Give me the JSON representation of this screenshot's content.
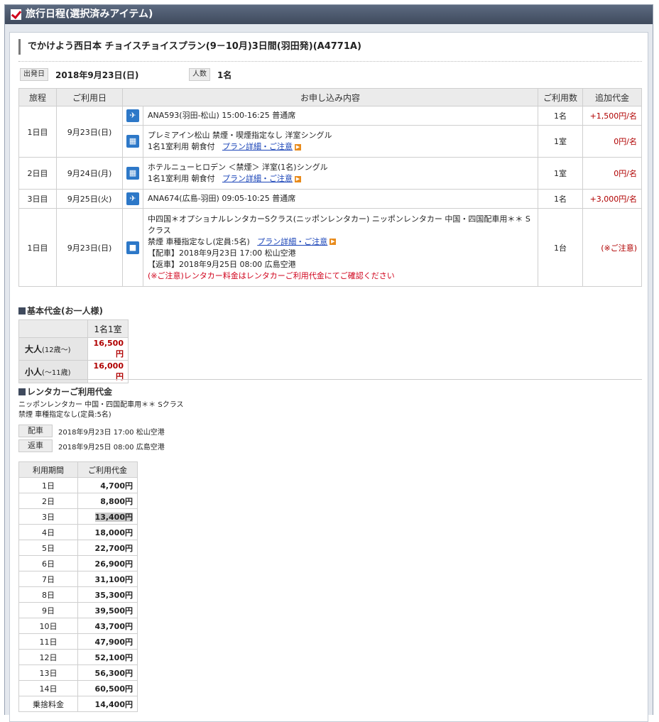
{
  "header": {
    "title": "旅行日程(選択済みアイテム)"
  },
  "plan": {
    "title": "でかけよう西日本 チョイスチョイスプラン(9－10月)3日間(羽田発)(A4771A)",
    "depart_label": "出発日",
    "depart_value": "2018年9月23日(日)",
    "people_label": "人数",
    "people_value": "1名"
  },
  "items_table": {
    "headers": [
      "旅程",
      "ご利用日",
      "お申し込み内容",
      "ご利用数",
      "追加代金"
    ],
    "rows": [
      {
        "day": "1日目",
        "date": "9月23日(日)",
        "icon": "plane-icon",
        "line1": "ANA593(羽田-松山) 15:00-16:25 普通席",
        "count": "1名",
        "price": "+1,500円/名"
      },
      {
        "icon": "hotel-icon",
        "line1": "プレミアイン松山 禁煙・喫煙指定なし 洋室シングル",
        "line2": "1名1室利用 朝食付",
        "link": "プラン詳細・ご注意",
        "count": "1室",
        "price": "0円/名"
      },
      {
        "day": "2日目",
        "date": "9月24日(月)",
        "icon": "hotel-icon",
        "line1": "ホテルニューヒロデン ＜禁煙＞ 洋室(1名)シングル",
        "line2": "1名1室利用 朝食付",
        "link": "プラン詳細・ご注意",
        "count": "1室",
        "price": "0円/名"
      },
      {
        "day": "3日目",
        "date": "9月25日(火)",
        "icon": "plane-icon",
        "line1": "ANA674(広島-羽田) 09:05-10:25 普通席",
        "count": "1名",
        "price": "+3,000円/名"
      },
      {
        "day": "1日目",
        "date": "9月23日(日)",
        "icon": "car-icon",
        "line1": "中四国＊オプショナルレンタカーSクラス(ニッポンレンタカー) ニッポンレンタカー 中国・四国配車用＊＊ Sクラス",
        "line2": "禁煙 車種指定なし(定員:5名)",
        "link": "プラン詳細・ご注意",
        "line3": "【配車】2018年9月23日 17:00 松山空港",
        "line4": "【返車】2018年9月25日 08:00 広島空港",
        "note": "(※ご注意)レンタカー料金はレンタカーご利用代金にてご確認ください",
        "count": "1台",
        "price": "(※ご注意)"
      }
    ]
  },
  "base_price": {
    "title": "基本代金(お一人様)",
    "col": "1名1室",
    "rows": [
      {
        "label": "大人",
        "sub": "(12歳～)",
        "value": "16,500円"
      },
      {
        "label": "小人",
        "sub": "(～11歳)",
        "value": "16,000円"
      }
    ]
  },
  "rental": {
    "title": "レンタカーご利用代金",
    "desc1": "ニッポンレンタカー 中国・四国配車用＊＊ Sクラス",
    "desc2": "禁煙 車種指定なし(定員:5名)",
    "pickup_label": "配車",
    "pickup_value": "2018年9月23日 17:00 松山空港",
    "return_label": "返車",
    "return_value": "2018年9月25日 08:00 広島空港",
    "headers": [
      "利用期間",
      "ご利用代金"
    ],
    "rows": [
      {
        "d": "1日",
        "p": "4,700円"
      },
      {
        "d": "2日",
        "p": "8,800円"
      },
      {
        "d": "3日",
        "p": "13,400円"
      },
      {
        "d": "4日",
        "p": "18,000円"
      },
      {
        "d": "5日",
        "p": "22,700円"
      },
      {
        "d": "6日",
        "p": "26,900円"
      },
      {
        "d": "7日",
        "p": "31,100円"
      },
      {
        "d": "8日",
        "p": "35,300円"
      },
      {
        "d": "9日",
        "p": "39,500円"
      },
      {
        "d": "10日",
        "p": "43,700円"
      },
      {
        "d": "11日",
        "p": "47,900円"
      },
      {
        "d": "12日",
        "p": "52,100円"
      },
      {
        "d": "13日",
        "p": "56,300円"
      },
      {
        "d": "14日",
        "p": "60,500円"
      },
      {
        "d": "乗捨料金",
        "p": "14,400円"
      }
    ]
  }
}
